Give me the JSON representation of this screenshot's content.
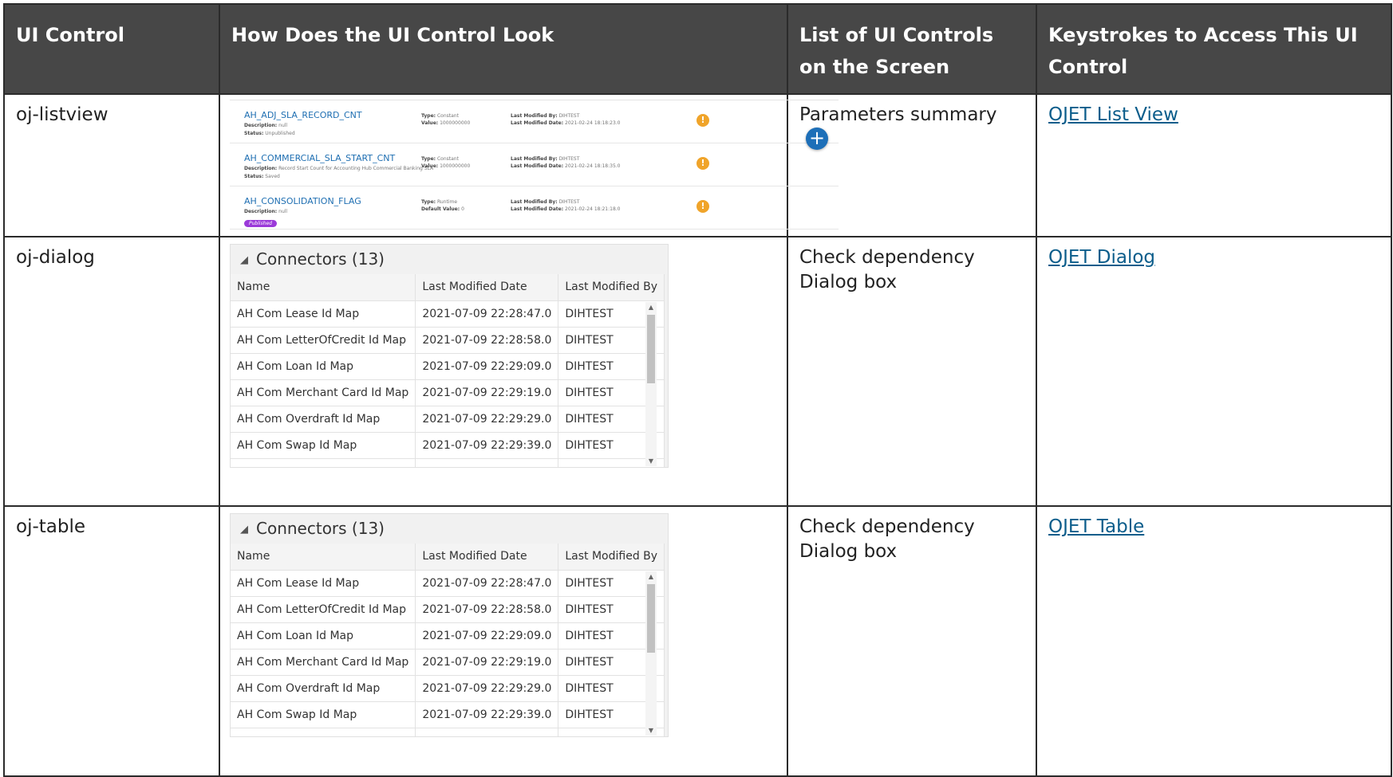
{
  "headers": [
    "UI Control",
    "How Does the UI Control Look",
    "List of UI Controls on the Screen",
    "Keystrokes to Access This UI Control"
  ],
  "rows": [
    {
      "control": "oj-listview",
      "list": "Parameters summary",
      "link": "OJET List View"
    },
    {
      "control": "oj-dialog",
      "list": "Check dependency Dialog box",
      "link": "OJET Dialog"
    },
    {
      "control": "oj-table",
      "list": "Check dependency Dialog box",
      "link": "OJET Table"
    }
  ],
  "listview": {
    "items": [
      {
        "name": "AH_ADJ_SLA_RECORD_CNT",
        "desc_label": "Description:",
        "desc": "null",
        "status_label": "Status:",
        "status": "Unpublished",
        "type_label": "Type:",
        "type": "Constant",
        "value_label": "Value:",
        "value": "1000000000",
        "by_label": "Last Modified By:",
        "by": "DIHTEST",
        "date_label": "Last Modified Date:",
        "date": "2021-02-24 18:18:23.0"
      },
      {
        "name": "AH_COMMERCIAL_SLA_START_CNT",
        "desc_label": "Description:",
        "desc": "Record Start Count for Accounting Hub Commercial Banking SLA",
        "status_label": "Status:",
        "status": "Saved",
        "type_label": "Type:",
        "type": "Constant",
        "value_label": "Value:",
        "value": "1000000000",
        "by_label": "Last Modified By:",
        "by": "DIHTEST",
        "date_label": "Last Modified Date:",
        "date": "2021-02-24 18:18:35.0"
      },
      {
        "name": "AH_CONSOLIDATION_FLAG",
        "desc_label": "Description:",
        "desc": "null",
        "badge": "Published",
        "type_label": "Type:",
        "type": "Runtime",
        "value_label": "Default Value:",
        "value": "0",
        "by_label": "Last Modified By:",
        "by": "DIHTEST",
        "date_label": "Last Modified Date:",
        "date": "2021-02-24 18:21:18.0"
      }
    ],
    "add_icon": "plus-icon",
    "warn_icon": "warning-icon"
  },
  "connectors": {
    "title": "Connectors (13)",
    "columns": [
      "Name",
      "Last Modified Date",
      "Last Modified By"
    ],
    "rows": [
      [
        "AH Com Lease Id Map",
        "2021-07-09 22:28:47.0",
        "DIHTEST"
      ],
      [
        "AH Com LetterOfCredit Id Map",
        "2021-07-09 22:28:58.0",
        "DIHTEST"
      ],
      [
        "AH Com Loan Id Map",
        "2021-07-09 22:29:09.0",
        "DIHTEST"
      ],
      [
        "AH Com Merchant Card Id Map",
        "2021-07-09 22:29:19.0",
        "DIHTEST"
      ],
      [
        "AH Com Overdraft Id Map",
        "2021-07-09 22:29:29.0",
        "DIHTEST"
      ],
      [
        "AH Com Swap Id Map",
        "2021-07-09 22:29:39.0",
        "DIHTEST"
      ]
    ]
  }
}
